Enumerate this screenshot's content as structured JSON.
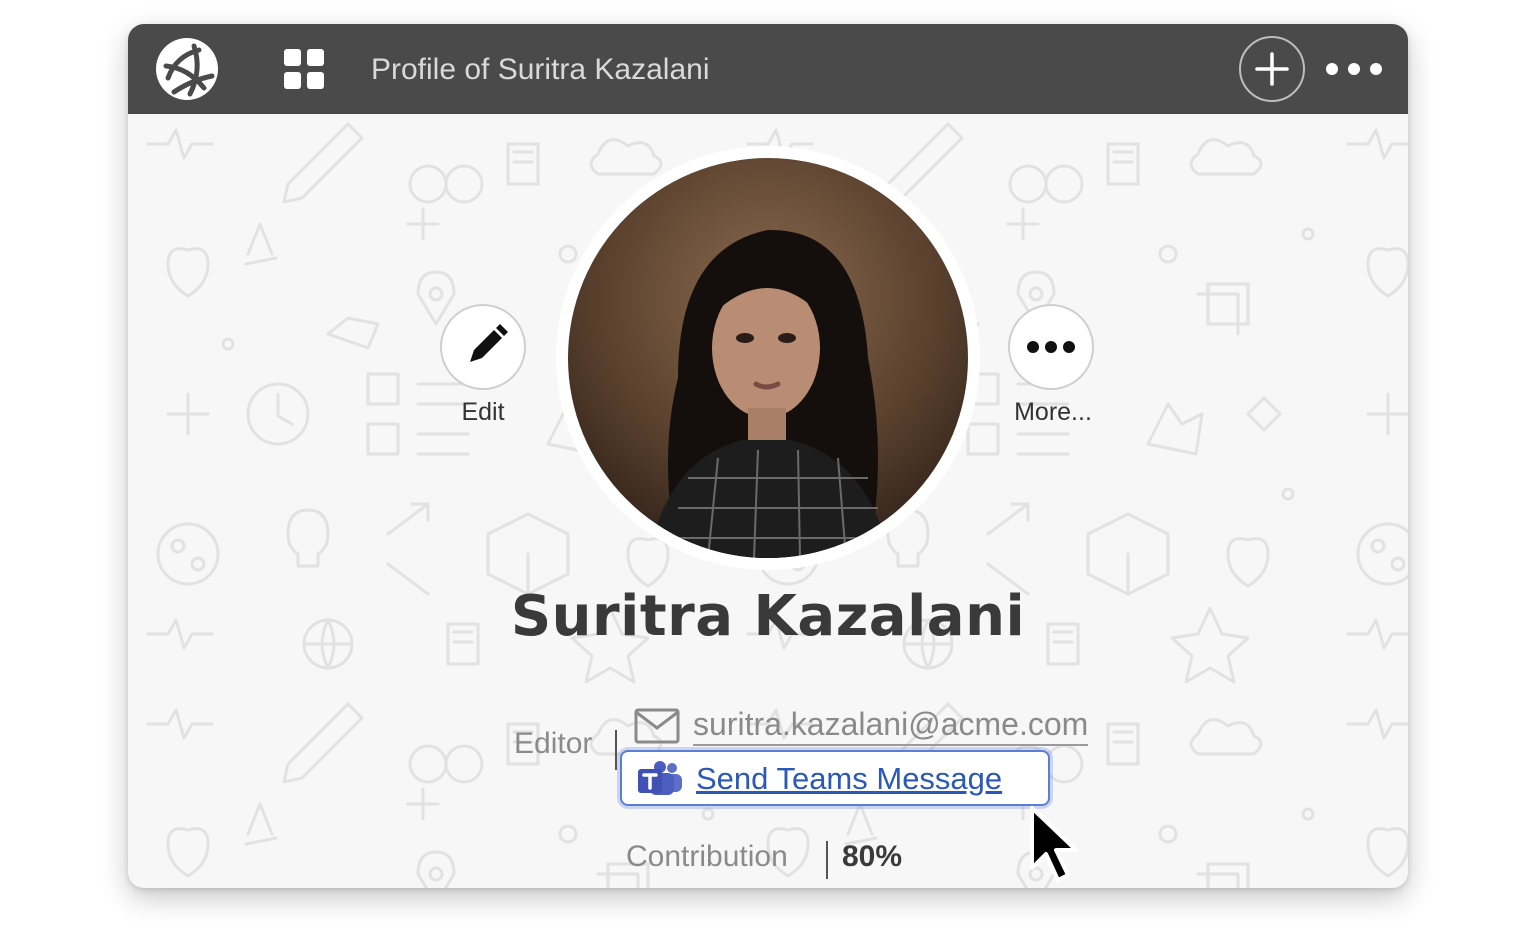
{
  "window": {
    "title": "Profile of Suritra Kazalani"
  },
  "header": {
    "logo_icon": "globe-logo-icon",
    "apps_icon": "grid-apps-icon",
    "add_icon": "plus-icon",
    "menu_icon": "more-horizontal-icon"
  },
  "profile": {
    "name": "Suritra Kazalani",
    "role": "Editor",
    "email": "suritra.kazalani@acme.com",
    "teams_label": "Send Teams Message",
    "contribution_label": "Contribution",
    "contribution_value": "80%"
  },
  "actions": {
    "edit_label": "Edit",
    "more_label": "More..."
  },
  "colors": {
    "titlebar": "#4a4a4a",
    "link": "#2c58b8",
    "focus_border": "#5b7fd4",
    "background": "#f7f7f7"
  }
}
